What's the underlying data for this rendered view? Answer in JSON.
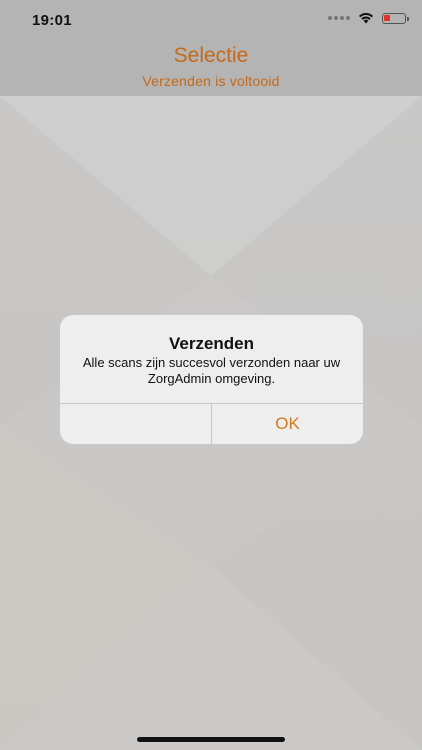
{
  "status_bar": {
    "time": "19:01",
    "icons": [
      "signal-dots-icon",
      "wifi-icon",
      "battery-low-icon"
    ],
    "battery_color": "#e0312b"
  },
  "nav": {
    "title": "Selectie",
    "subtitle": "Verzenden is voltooid"
  },
  "alert": {
    "title": "Verzenden",
    "message": "Alle scans zijn succesvol verzonden naar uw ZorgAdmin omgeving.",
    "left_button_label": "",
    "ok_label": "OK"
  },
  "colors": {
    "accent": "#c46a18",
    "header_bg": "#b4b4b4",
    "alert_bg": "#eeeeee"
  }
}
